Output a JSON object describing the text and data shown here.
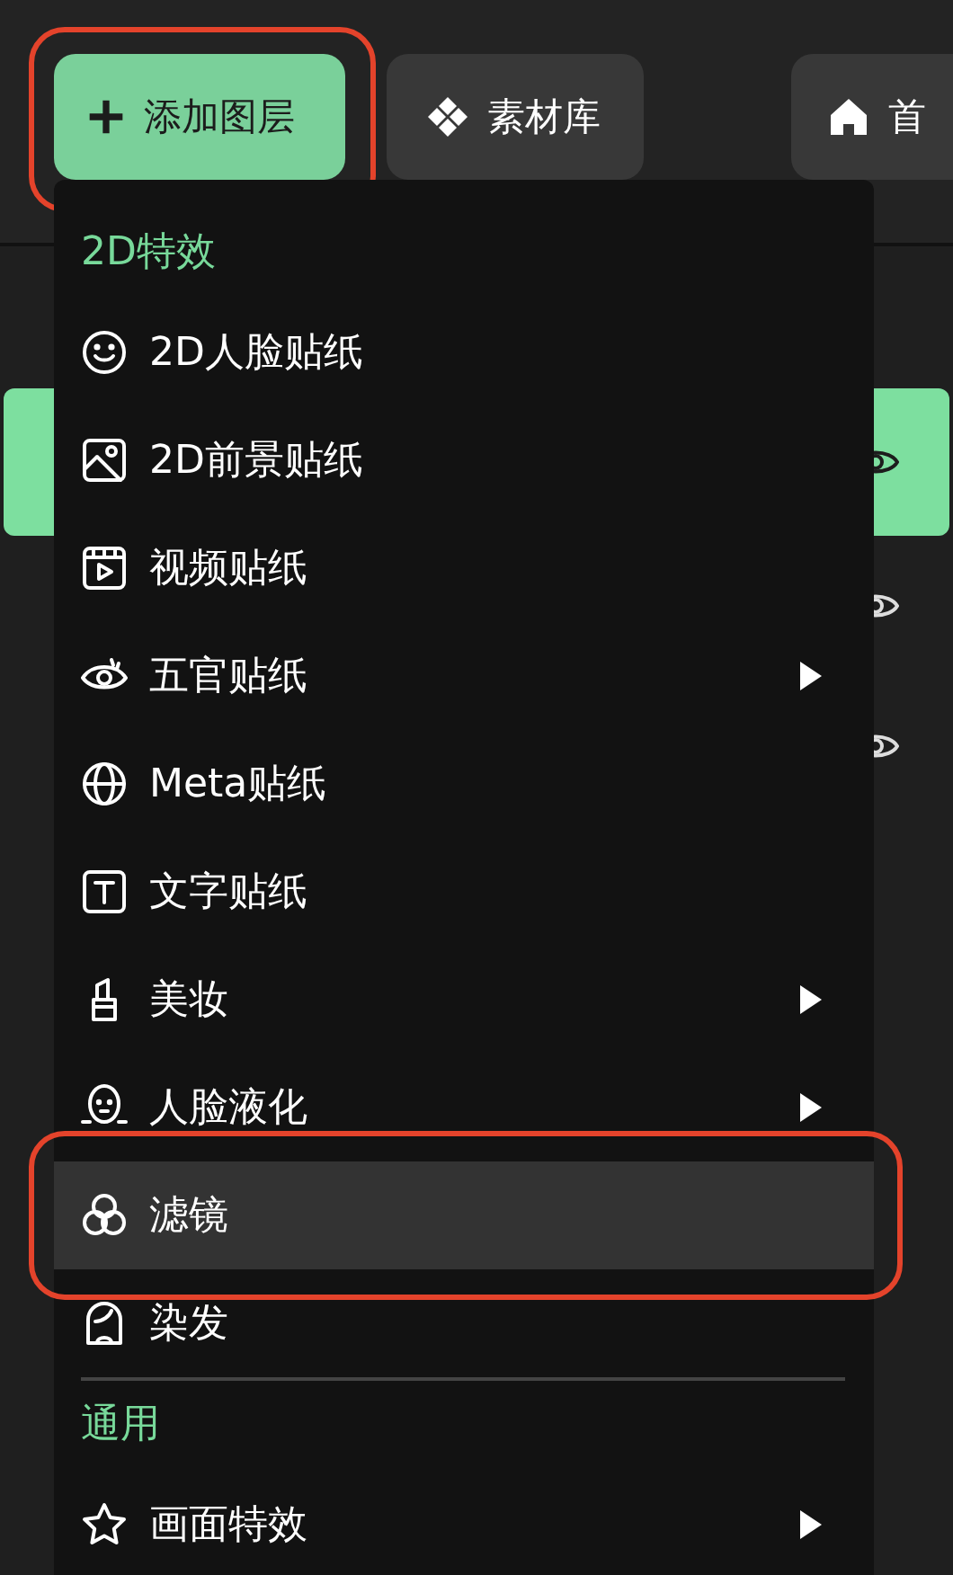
{
  "toolbar": {
    "buttons": [
      {
        "label": "添加图层",
        "kind": "add",
        "highlighted": true
      },
      {
        "label": "素材库",
        "kind": "library",
        "highlighted": false
      },
      {
        "label": "首",
        "kind": "home",
        "highlighted": false
      }
    ]
  },
  "layers": [
    {
      "selected": true
    },
    {
      "selected": false
    },
    {
      "selected": false
    }
  ],
  "menu": {
    "sections": [
      {
        "title": "2D特效",
        "items": [
          {
            "label": "2D人脸贴纸",
            "kind": "smiley",
            "submenu": false,
            "selected": false,
            "highlighted": false
          },
          {
            "label": "2D前景贴纸",
            "kind": "image",
            "submenu": false,
            "selected": false,
            "highlighted": false
          },
          {
            "label": "视频贴纸",
            "kind": "video",
            "submenu": false,
            "selected": false,
            "highlighted": false
          },
          {
            "label": "五官贴纸",
            "kind": "eye",
            "submenu": true,
            "selected": false,
            "highlighted": false
          },
          {
            "label": "Meta贴纸",
            "kind": "globe",
            "submenu": false,
            "selected": false,
            "highlighted": false
          },
          {
            "label": "文字贴纸",
            "kind": "text",
            "submenu": false,
            "selected": false,
            "highlighted": false
          },
          {
            "label": "美妆",
            "kind": "lipstick",
            "submenu": true,
            "selected": false,
            "highlighted": false
          },
          {
            "label": "人脸液化",
            "kind": "face",
            "submenu": true,
            "selected": false,
            "highlighted": false
          },
          {
            "label": "滤镜",
            "kind": "circles",
            "submenu": false,
            "selected": true,
            "highlighted": true
          },
          {
            "label": "染发",
            "kind": "hair",
            "submenu": false,
            "selected": false,
            "highlighted": false
          }
        ]
      },
      {
        "title": "通用",
        "items": [
          {
            "label": "画面特效",
            "kind": "star",
            "submenu": true,
            "selected": false,
            "highlighted": false
          }
        ]
      }
    ]
  }
}
